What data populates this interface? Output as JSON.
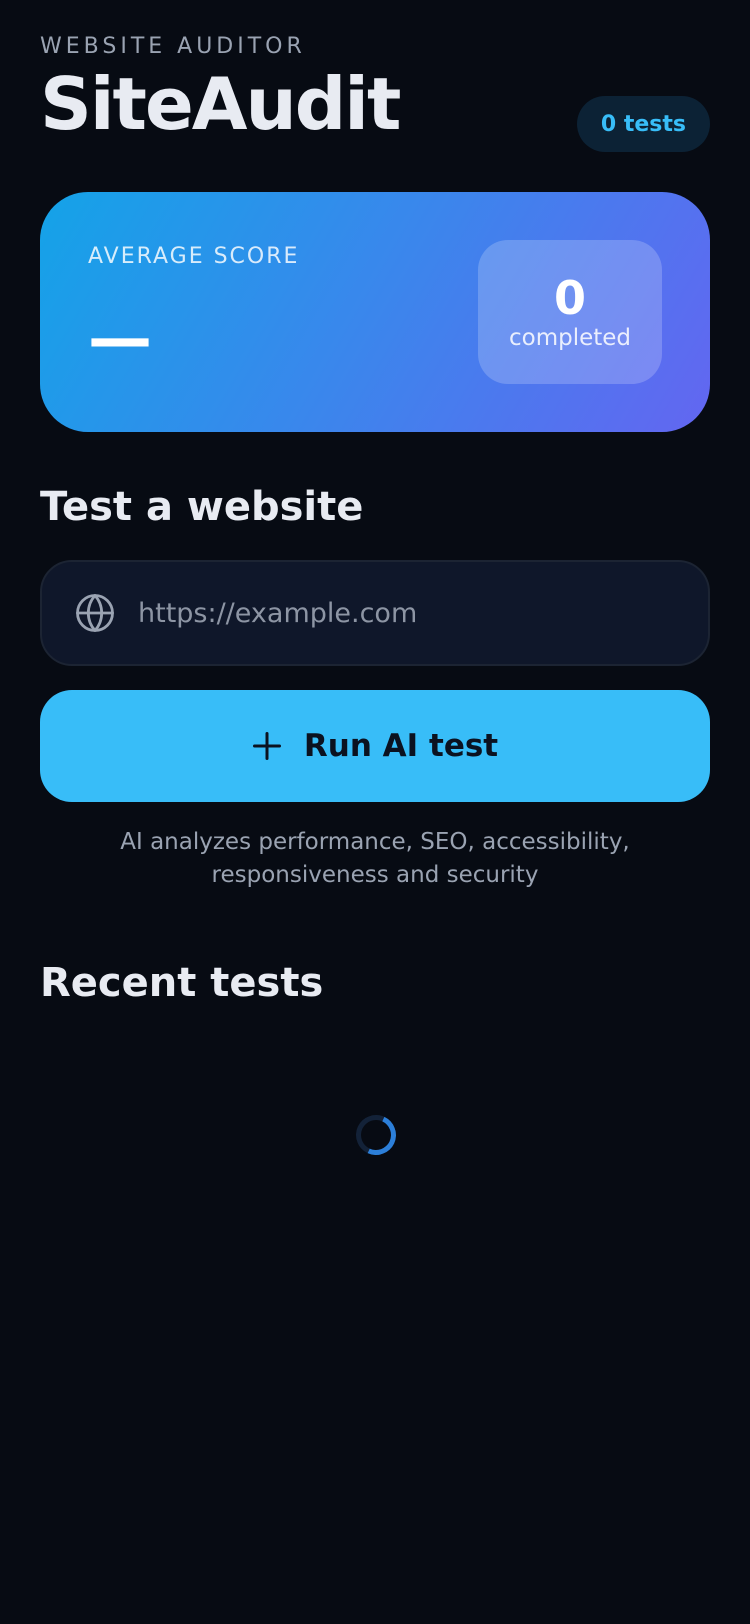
{
  "header": {
    "eyebrow": "WEBSITE AUDITOR",
    "title": "SiteAudit",
    "count_badge": "0 tests"
  },
  "score_card": {
    "label": "AVERAGE SCORE",
    "value": "—",
    "completed_count": "0",
    "completed_label": "completed"
  },
  "test_section": {
    "title": "Test a website",
    "url_placeholder": "https://example.com",
    "url_value": "",
    "run_button_label": "Run AI test",
    "hint": "AI analyzes performance, SEO, accessibility, responsiveness and security"
  },
  "recent_section": {
    "title": "Recent tests",
    "loading": true
  },
  "icons": {
    "url_field": "globe-icon",
    "run_button": "plus-icon",
    "loading": "loading-spinner"
  },
  "colors": {
    "background": "#070b13",
    "accent": "#38bdf8",
    "gradient_start": "#14a3e8",
    "gradient_end": "#6366f1"
  }
}
